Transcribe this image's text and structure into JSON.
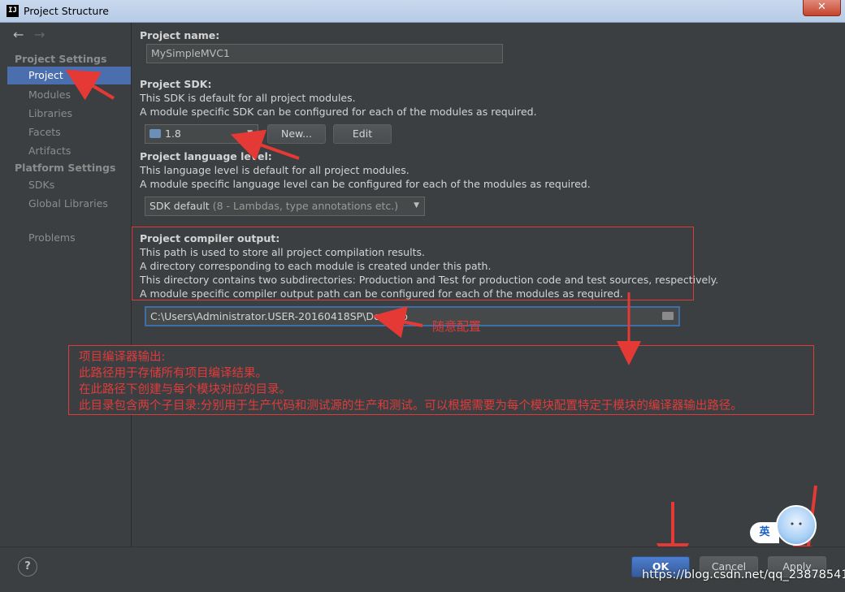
{
  "window": {
    "title": "Project Structure",
    "close_label": "✕"
  },
  "sidebar": {
    "back_icon": "arrow-left-icon",
    "forward_icon": "arrow-right-icon",
    "project_settings_header": "Project Settings",
    "project_settings_items": [
      {
        "label": "Project",
        "selected": true
      },
      {
        "label": "Modules",
        "selected": false
      },
      {
        "label": "Libraries",
        "selected": false
      },
      {
        "label": "Facets",
        "selected": false
      },
      {
        "label": "Artifacts",
        "selected": false
      }
    ],
    "platform_settings_header": "Platform Settings",
    "platform_settings_items": [
      {
        "label": "SDKs"
      },
      {
        "label": "Global Libraries"
      }
    ],
    "problems_label": "Problems"
  },
  "main": {
    "project_name_label": "Project name:",
    "project_name_value": "MySimpleMVC1",
    "sdk_label": "Project SDK:",
    "sdk_desc_1": "This SDK is default for all project modules.",
    "sdk_desc_2": "A module specific SDK can be configured for each of the modules as required.",
    "sdk_value": "1.8",
    "sdk_new_button": "New...",
    "sdk_edit_button": "Edit",
    "lang_label": "Project language level:",
    "lang_desc_1": "This language level is default for all project modules.",
    "lang_desc_2": "A module specific language level can be configured for each of the modules as required.",
    "lang_value_main": "SDK default",
    "lang_value_detail": "(8 - Lambdas, type annotations etc.)",
    "compiler_label": "Project compiler output:",
    "compiler_desc_1": "This path is used to store all project compilation results.",
    "compiler_desc_2": "A directory corresponding to each module is created under this path.",
    "compiler_desc_3": "This directory contains two subdirectories: Production and Test for production code and test sources, respectively.",
    "compiler_desc_4": "A module specific compiler output path can be configured for each of the modules as required.",
    "compiler_path": "C:\\Users\\Administrator.USER-20160418SP\\Desktop"
  },
  "annotations": {
    "arbitrary_config": "随意配置",
    "line_1": "项目编译器输出:",
    "line_2": "此路径用于存储所有项目编译结果。",
    "line_3": "在此路径下创建与每个模块对应的目录。",
    "line_4": "此目录包含两个子目录:分别用于生产代码和测试源的生产和测试。可以根据需要为每个模块配置特定于模块的编译器输出路径。",
    "color": "#e03b3b"
  },
  "footer": {
    "help_label": "?",
    "ok_label": "OK",
    "cancel_label": "Cancel",
    "apply_label": "Apply"
  },
  "overlay": {
    "watermark": "https://blog.csdn.net/qq_23878541",
    "ime_label": "英"
  }
}
